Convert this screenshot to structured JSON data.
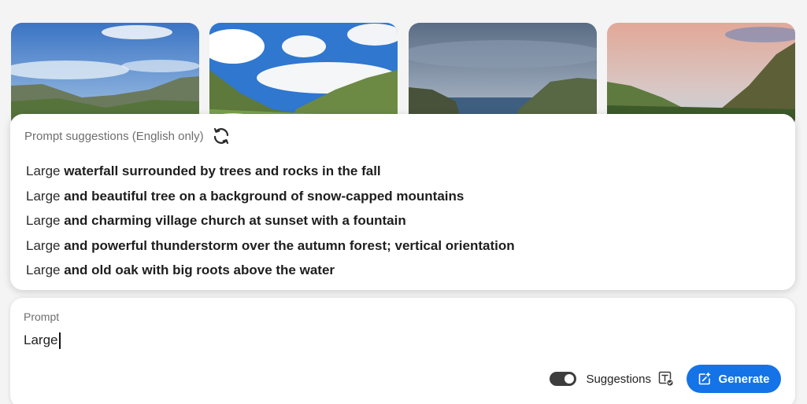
{
  "gallery": {
    "images": [
      {
        "subject": "mountain valley under blue sky"
      },
      {
        "subject": "green hills with cumulus clouds"
      },
      {
        "subject": "coastal cliffs under overcast sky"
      },
      {
        "subject": "steep green slopes at sunset"
      }
    ]
  },
  "suggestions": {
    "title": "Prompt suggestions (English only)",
    "refresh_icon": "refresh-icon",
    "items": [
      {
        "prefix": "Large ",
        "rest": "waterfall surrounded by trees and rocks in the fall"
      },
      {
        "prefix": "Large ",
        "rest": "and beautiful tree on a background of snow-capped mountains"
      },
      {
        "prefix": "Large ",
        "rest": "and charming village church at sunset with a fountain"
      },
      {
        "prefix": "Large ",
        "rest": "and powerful thunderstorm over the autumn forest; vertical orientation"
      },
      {
        "prefix": "Large ",
        "rest": "and old oak with big roots above the water"
      }
    ]
  },
  "prompt": {
    "label": "Prompt",
    "value": "Large"
  },
  "controls": {
    "toggle_on": true,
    "suggestions_label": "Suggestions",
    "text_check_icon": "text-check-icon",
    "generate_label": "Generate",
    "generate_icon": "sparkle-edit-icon",
    "accent": "#1473e6"
  }
}
